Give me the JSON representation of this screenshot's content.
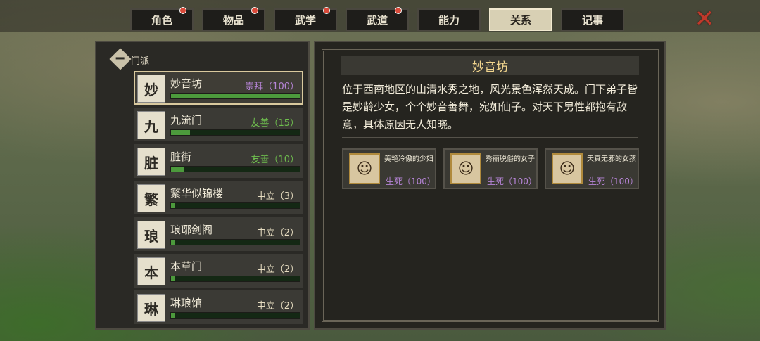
{
  "tabs": [
    {
      "label": "角色",
      "badge": true,
      "active": false
    },
    {
      "label": "物品",
      "badge": true,
      "active": false
    },
    {
      "label": "武学",
      "badge": true,
      "active": false
    },
    {
      "label": "武道",
      "badge": true,
      "active": false
    },
    {
      "label": "能力",
      "badge": false,
      "active": false
    },
    {
      "label": "关系",
      "badge": false,
      "active": true
    },
    {
      "label": "记事",
      "badge": false,
      "active": false
    }
  ],
  "close_icon": "✕",
  "group": {
    "icon": "minus-diamond-icon",
    "label": "门派"
  },
  "factions": [
    {
      "name": "妙音坊",
      "status": "崇拜（100）",
      "status_color": "#b785d8",
      "progress": 1.0,
      "emblem": "妙",
      "selected": true
    },
    {
      "name": "九流门",
      "status": "友善（15）",
      "status_color": "#6fbf4e",
      "progress": 0.15,
      "emblem": "九",
      "selected": false
    },
    {
      "name": "脏街",
      "status": "友善（10）",
      "status_color": "#6fbf4e",
      "progress": 0.1,
      "emblem": "脏",
      "selected": false
    },
    {
      "name": "繁华似锦楼",
      "status": "中立（3）",
      "status_color": "#e6dcc0",
      "progress": 0.03,
      "emblem": "繁",
      "selected": false
    },
    {
      "name": "琅琊剑阁",
      "status": "中立（2）",
      "status_color": "#e6dcc0",
      "progress": 0.02,
      "emblem": "琅",
      "selected": false
    },
    {
      "name": "本草门",
      "status": "中立（2）",
      "status_color": "#e6dcc0",
      "progress": 0.02,
      "emblem": "本",
      "selected": false
    },
    {
      "name": "琳琅馆",
      "status": "中立（2）",
      "status_color": "#e6dcc0",
      "progress": 0.02,
      "emblem": "琳",
      "selected": false
    }
  ],
  "detail": {
    "title": "妙音坊",
    "description": "位于西南地区的山清水秀之地，风光景色浑然天成。门下弟子皆是妙龄少女，个个妙音善舞，宛如仙子。对天下男性都抱有敌意，具体原因无人知晓。",
    "members": [
      {
        "name": "美艳冷傲的少妇",
        "relation": "生死（100）",
        "portrait": "☺"
      },
      {
        "name": "秀丽脱俗的女子",
        "relation": "生死（100）",
        "portrait": "☺"
      },
      {
        "name": "天真无邪的女孩",
        "relation": "生死（100）",
        "portrait": "☺"
      }
    ]
  }
}
